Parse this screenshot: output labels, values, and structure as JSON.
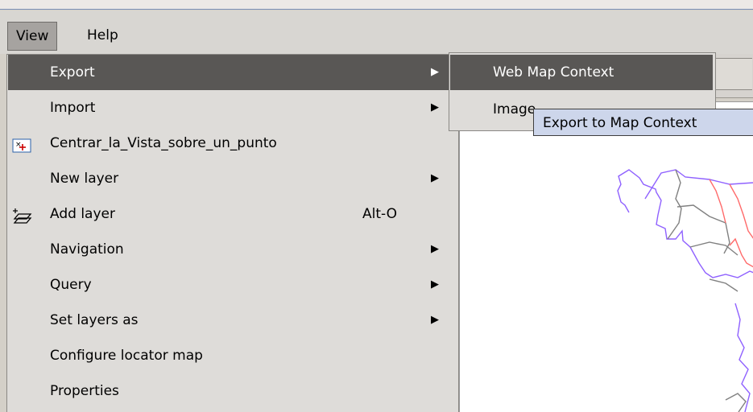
{
  "menubar": {
    "items": [
      {
        "label": "View"
      },
      {
        "label": "Help"
      }
    ]
  },
  "view_menu": {
    "items": [
      {
        "label": "Export",
        "submenu": true,
        "selected": true
      },
      {
        "label": "Import",
        "submenu": true
      },
      {
        "label": "Centrar_la_Vista_sobre_un_punto",
        "icon": "center-view-icon"
      },
      {
        "label": "New layer",
        "submenu": true
      },
      {
        "label": "Add layer",
        "shortcut": "Alt-O",
        "icon": "add-layer-icon"
      },
      {
        "label": "Navigation",
        "submenu": true
      },
      {
        "label": "Query",
        "submenu": true
      },
      {
        "label": "Set layers as",
        "submenu": true
      },
      {
        "label": "Configure locator map"
      },
      {
        "label": "Properties"
      }
    ]
  },
  "export_submenu": {
    "items": [
      {
        "label": "Web Map Context",
        "selected": true
      },
      {
        "label": "Image"
      }
    ]
  },
  "tooltip": {
    "text": "Export to Map Context"
  },
  "colors": {
    "selected_bg": "#595755",
    "tooltip_bg": "#cdd6eb",
    "map_purple": "#8f61ff",
    "map_red": "#ff6a6a",
    "map_gray": "#808080"
  }
}
